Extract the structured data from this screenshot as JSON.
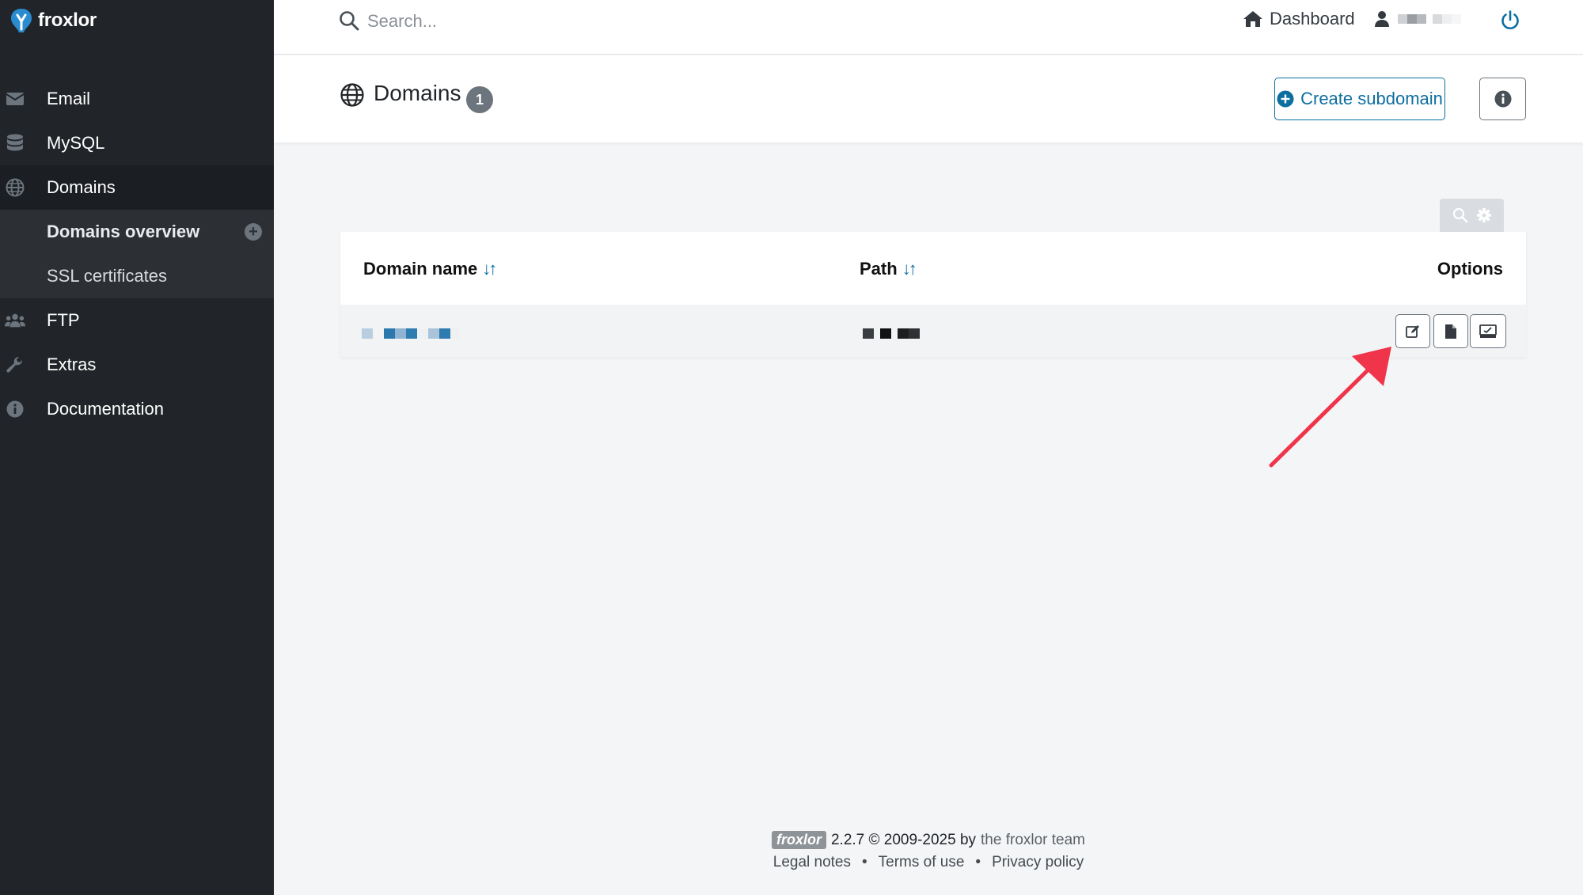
{
  "app": {
    "name": "froxlor"
  },
  "sidebar": {
    "items": [
      {
        "label": "Email",
        "icon": "envelope-icon"
      },
      {
        "label": "MySQL",
        "icon": "database-icon"
      },
      {
        "label": "Domains",
        "icon": "globe-icon"
      },
      {
        "label": "FTP",
        "icon": "users-icon"
      },
      {
        "label": "Extras",
        "icon": "wrench-icon"
      },
      {
        "label": "Documentation",
        "icon": "info-icon"
      }
    ],
    "subitems": [
      {
        "label": "Domains overview"
      },
      {
        "label": "SSL certificates"
      }
    ]
  },
  "topbar": {
    "search_placeholder": "Search...",
    "dashboard_label": "Dashboard"
  },
  "page": {
    "title": "Domains",
    "count": "1",
    "create_button": "Create subdomain"
  },
  "table": {
    "columns": [
      "Domain name",
      "Path",
      "Options"
    ],
    "sort_glyph": "↓↑"
  },
  "footer": {
    "logo_text": "froxlor",
    "version_text": "2.2.7 © 2009-2025 by",
    "team_text": "the froxlor team",
    "links": [
      "Legal notes",
      "Terms of use",
      "Privacy policy"
    ],
    "separator": "•"
  },
  "colors": {
    "accent": "#0d6ea0",
    "sidebar_bg": "#212529",
    "annotation_arrow": "#f0344a"
  }
}
